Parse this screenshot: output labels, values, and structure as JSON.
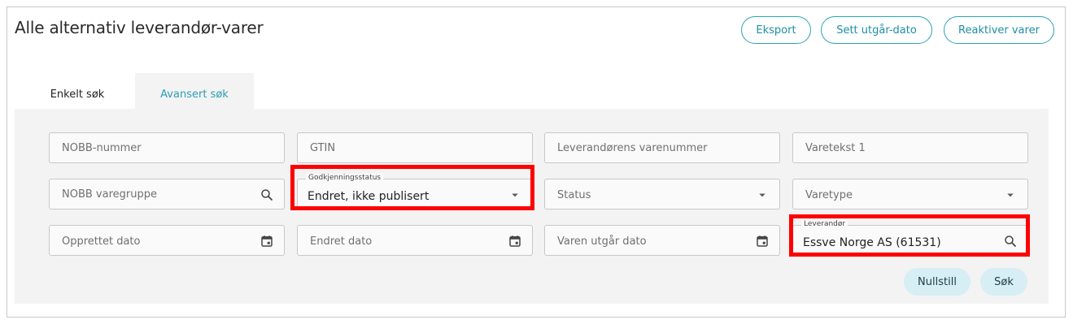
{
  "page": {
    "title": "Alle alternativ leverandør-varer"
  },
  "header_buttons": {
    "export": "Eksport",
    "set_expiry": "Sett utgår-dato",
    "reactivate": "Reaktiver varer"
  },
  "tabs": [
    {
      "label": "Enkelt søk",
      "active": false
    },
    {
      "label": "Avansert søk",
      "active": true
    }
  ],
  "search": {
    "nobb_number": {
      "placeholder": "NOBB-nummer"
    },
    "gtin": {
      "placeholder": "GTIN"
    },
    "supplier_item_number": {
      "placeholder": "Leverandørens varenummer"
    },
    "item_text": {
      "placeholder": "Varetekst 1"
    },
    "nobb_item_group": {
      "placeholder": "NOBB varegruppe"
    },
    "approval_status": {
      "label": "Godkjenningsstatus",
      "value": "Endret, ikke publisert"
    },
    "status": {
      "placeholder": "Status"
    },
    "item_type": {
      "placeholder": "Varetype"
    },
    "created_date": {
      "placeholder": "Opprettet dato"
    },
    "changed_date": {
      "placeholder": "Endret dato"
    },
    "expiry_date": {
      "placeholder": "Varen utgår dato"
    },
    "supplier": {
      "label": "Leverandør",
      "value": "Essve Norge AS (61531)"
    }
  },
  "actions": {
    "reset": "Nullstill",
    "search": "Søk"
  },
  "colors": {
    "accent": "#2aa3b5",
    "highlight": "#ff0000",
    "panel": "#f3f3f3",
    "pill": "#d6eef4"
  }
}
